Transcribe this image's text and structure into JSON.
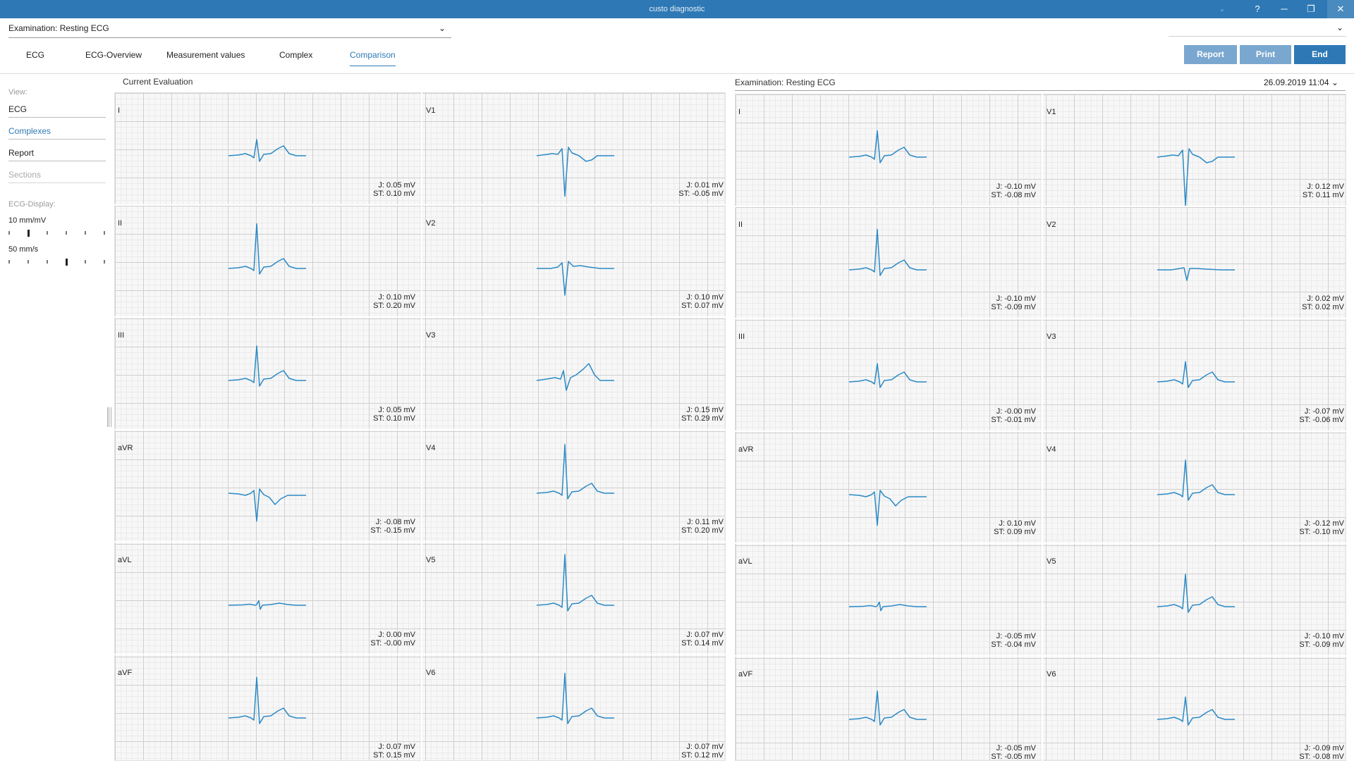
{
  "window": {
    "title": "custo diagnostic",
    "controls": {
      "help": "?",
      "minimize": "─",
      "restore": "❐",
      "close": "✕",
      "dropdown": "⌄"
    }
  },
  "header": {
    "exam_select": "Examination: Resting ECG",
    "chevron": "⌄"
  },
  "tabs": [
    {
      "label": "ECG",
      "active": false
    },
    {
      "label": "ECG-Overview",
      "active": false
    },
    {
      "label": "Measurement values",
      "active": false
    },
    {
      "label": "Complex",
      "active": false
    },
    {
      "label": "Comparison",
      "active": true
    }
  ],
  "buttons": {
    "report": "Report",
    "print": "Print",
    "end": "End"
  },
  "sidebar": {
    "view_label": "View:",
    "items": [
      {
        "label": "ECG",
        "state": "normal"
      },
      {
        "label": "Complexes",
        "state": "active"
      },
      {
        "label": "Report",
        "state": "normal"
      },
      {
        "label": "Sections",
        "state": "disabled"
      }
    ],
    "display_label": "ECG-Display:",
    "gain_label": "10 mm/mV",
    "gain_position": 0.2,
    "speed_label": "50 mm/s",
    "speed_position": 0.6
  },
  "left_panel": {
    "title": "Current Evaluation",
    "cells": [
      {
        "lead": "I",
        "j": "J: 0.05 mV",
        "st": "ST: 0.10 mV",
        "shape": "pos",
        "amp": 0.8
      },
      {
        "lead": "V1",
        "j": "J: 0.01 mV",
        "st": "ST: -0.05 mV",
        "shape": "v1",
        "amp": 1.0
      },
      {
        "lead": "II",
        "j": "J: 0.10 mV",
        "st": "ST: 0.20 mV",
        "shape": "pos",
        "amp": 2.2
      },
      {
        "lead": "V2",
        "j": "J: 0.10 mV",
        "st": "ST: 0.07 mV",
        "shape": "v2",
        "amp": 1.0
      },
      {
        "lead": "III",
        "j": "J: 0.05 mV",
        "st": "ST: 0.10 mV",
        "shape": "pos",
        "amp": 1.7
      },
      {
        "lead": "V3",
        "j": "J: 0.15 mV",
        "st": "ST: 0.29 mV",
        "shape": "v3",
        "amp": 1.0
      },
      {
        "lead": "aVR",
        "j": "J: -0.08 mV",
        "st": "ST: -0.15 mV",
        "shape": "avr",
        "amp": 1.0
      },
      {
        "lead": "V4",
        "j": "J: 0.11 mV",
        "st": "ST: 0.20 mV",
        "shape": "pos",
        "amp": 2.4
      },
      {
        "lead": "aVL",
        "j": "J: 0.00 mV",
        "st": "ST: -0.00 mV",
        "shape": "flat",
        "amp": 0.4
      },
      {
        "lead": "V5",
        "j": "J: 0.07 mV",
        "st": "ST: 0.14 mV",
        "shape": "pos",
        "amp": 2.5
      },
      {
        "lead": "aVF",
        "j": "J: 0.07 mV",
        "st": "ST: 0.15 mV",
        "shape": "pos",
        "amp": 2.0
      },
      {
        "lead": "V6",
        "j": "J: 0.07 mV",
        "st": "ST: 0.12 mV",
        "shape": "pos",
        "amp": 2.2
      }
    ]
  },
  "right_panel": {
    "title": "Examination: Resting ECG",
    "date": "26.09.2019 11:04 ⌄",
    "cells": [
      {
        "lead": "I",
        "j": "J: -0.10 mV",
        "st": "ST: -0.08 mV",
        "shape": "pos",
        "amp": 1.3
      },
      {
        "lead": "V1",
        "j": "J: 0.12 mV",
        "st": "ST: 0.11 mV",
        "shape": "v1",
        "amp": 1.2
      },
      {
        "lead": "II",
        "j": "J: -0.10 mV",
        "st": "ST: -0.09 mV",
        "shape": "pos",
        "amp": 2.0
      },
      {
        "lead": "V2",
        "j": "J: 0.02 mV",
        "st": "ST: 0.02 mV",
        "shape": "v2s",
        "amp": 0.6
      },
      {
        "lead": "III",
        "j": "J: -0.00 mV",
        "st": "ST: -0.01 mV",
        "shape": "pos",
        "amp": 0.9
      },
      {
        "lead": "V3",
        "j": "J: -0.07 mV",
        "st": "ST: -0.06 mV",
        "shape": "pos",
        "amp": 1.0
      },
      {
        "lead": "aVR",
        "j": "J: 0.10 mV",
        "st": "ST: 0.09 mV",
        "shape": "avr",
        "amp": 1.1
      },
      {
        "lead": "V4",
        "j": "J: -0.12 mV",
        "st": "ST: -0.10 mV",
        "shape": "pos",
        "amp": 1.7
      },
      {
        "lead": "aVL",
        "j": "J: -0.05 mV",
        "st": "ST: -0.04 mV",
        "shape": "small",
        "amp": 0.4
      },
      {
        "lead": "V5",
        "j": "J: -0.10 mV",
        "st": "ST: -0.09 mV",
        "shape": "pos",
        "amp": 1.6
      },
      {
        "lead": "aVF",
        "j": "J: -0.05 mV",
        "st": "ST: -0.05 mV",
        "shape": "pos",
        "amp": 1.4
      },
      {
        "lead": "V6",
        "j": "J: -0.09 mV",
        "st": "ST: -0.08 mV",
        "shape": "pos",
        "amp": 1.1
      }
    ]
  },
  "colors": {
    "accent": "#2e79b5",
    "trace": "#2b8ac6",
    "button_light": "#7aa7cf"
  }
}
